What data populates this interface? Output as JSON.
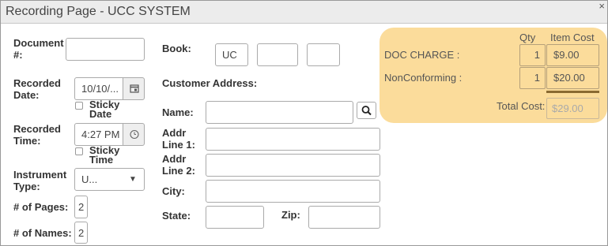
{
  "window": {
    "title": "Recording Page - UCC SYSTEM",
    "close_glyph": "×"
  },
  "left": {
    "document_label": "Document #:",
    "document_value": "",
    "recorded_date_label": "Recorded Date:",
    "recorded_date_value": "10/10/...",
    "sticky_date_label": "Sticky Date",
    "recorded_time_label": "Recorded Time:",
    "recorded_time_value": "4:27 PM",
    "sticky_time_label": "Sticky Time",
    "instrument_type_label": "Instrument Type:",
    "instrument_type_value": "U...",
    "pages_label": "# of Pages:",
    "pages_value": "2",
    "names_label": "# of Names:",
    "names_value": "2"
  },
  "middle": {
    "book_label": "Book:",
    "book_values": [
      "UC",
      "",
      ""
    ],
    "customer_address_label": "Customer Address:",
    "name_label": "Name:",
    "addr1_label": "Addr Line 1:",
    "addr2_label": "Addr Line 2:",
    "city_label": "City:",
    "state_label": "State:",
    "zip_label": "Zip:"
  },
  "charges": {
    "qty_header": "Qty",
    "cost_header": "Item Cost",
    "items": [
      {
        "label": "DOC CHARGE :",
        "qty": "1",
        "cost": "$9.00"
      },
      {
        "label": "NonConforming :",
        "qty": "1",
        "cost": "$20.00"
      }
    ],
    "total_label": "Total Cost:",
    "total_value": "$29.00"
  },
  "colors": {
    "panel": "#fbdc9b",
    "separator": "#8a6a32",
    "titlebar": "#ececec"
  },
  "icons": {
    "date": "calendar-icon",
    "time": "clock-icon",
    "select": "caret-down-icon",
    "search": "search-icon"
  }
}
